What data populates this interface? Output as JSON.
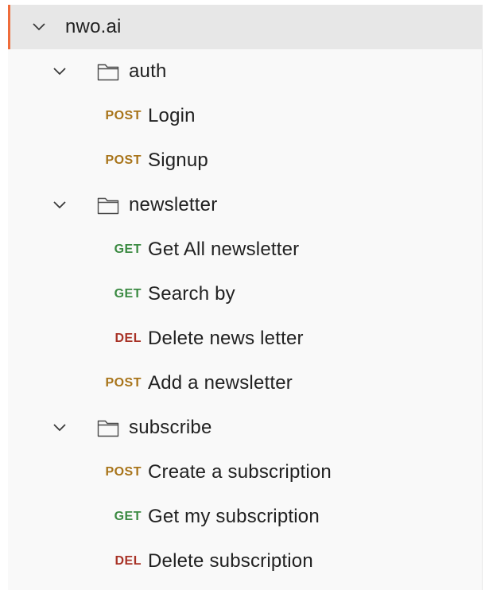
{
  "collection": {
    "name": "nwo.ai",
    "expanded": true,
    "selected": true
  },
  "folders": [
    {
      "name": "auth",
      "expanded": true,
      "requests": [
        {
          "method": "POST",
          "name": "Login"
        },
        {
          "method": "POST",
          "name": "Signup"
        }
      ]
    },
    {
      "name": "newsletter",
      "expanded": true,
      "requests": [
        {
          "method": "GET",
          "name": "Get All newsletter"
        },
        {
          "method": "GET",
          "name": "Search by"
        },
        {
          "method": "DEL",
          "name": "Delete news letter"
        },
        {
          "method": "POST",
          "name": "Add a newsletter"
        }
      ]
    },
    {
      "name": "subscribe",
      "expanded": true,
      "requests": [
        {
          "method": "POST",
          "name": "Create a subscription"
        },
        {
          "method": "GET",
          "name": "Get my subscription"
        },
        {
          "method": "DEL",
          "name": "Delete subscription"
        }
      ]
    }
  ],
  "icons": {
    "expand": "chevron-down-icon",
    "folder": "folder-icon"
  },
  "colors": {
    "accent": "#ef6c3b",
    "post": "#a8741a",
    "get": "#3b8a42",
    "del": "#a83226",
    "selected_bg": "#e7e7e7",
    "panel_bg": "#f9f9f9"
  }
}
